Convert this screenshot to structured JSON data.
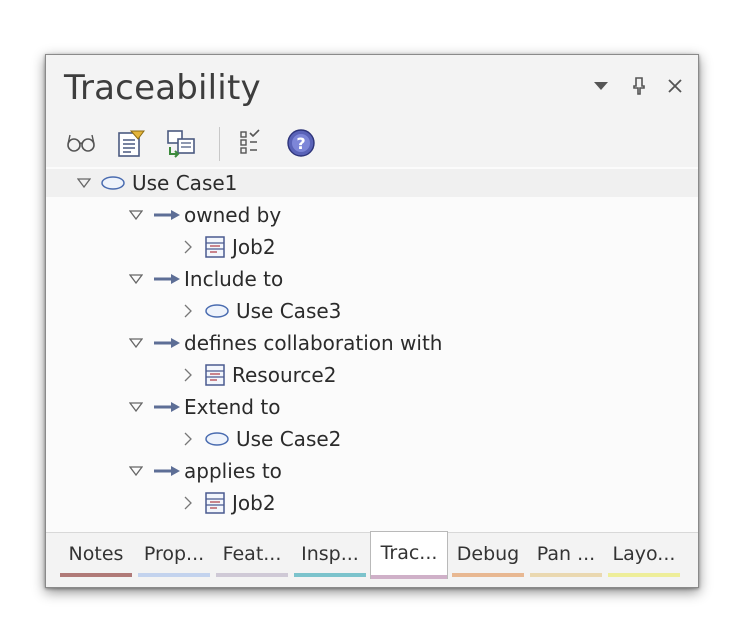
{
  "window": {
    "title": "Traceability",
    "controls": {
      "menu_icon": "dropdown-arrow-icon",
      "pin_icon": "pin-icon",
      "close_icon": "close-icon"
    }
  },
  "toolbar": {
    "buttons": [
      {
        "name": "view-icon"
      },
      {
        "name": "properties-icon"
      },
      {
        "name": "locate-icon"
      },
      {
        "name": "checklist-icon"
      },
      {
        "name": "help-icon"
      }
    ]
  },
  "tree": {
    "root": {
      "label": "Use Case1",
      "icon": "use-case-icon"
    },
    "groups": [
      {
        "label": "owned by",
        "child": "Job2",
        "child_icon": "class-icon"
      },
      {
        "label": "Include to",
        "child": "Use Case3",
        "child_icon": "use-case-icon"
      },
      {
        "label": "defines collaboration with",
        "child": "Resource2",
        "child_icon": "class-icon"
      },
      {
        "label": "Extend to",
        "child": "Use Case2",
        "child_icon": "use-case-icon"
      },
      {
        "label": "applies to",
        "child": "Job2",
        "child_icon": "class-icon"
      }
    ]
  },
  "tabs": [
    {
      "label": "Notes",
      "color": "#b07a78"
    },
    {
      "label": "Prop...",
      "color": "#c3d3ee"
    },
    {
      "label": "Feat...",
      "color": "#cfc9d6"
    },
    {
      "label": "Insp...",
      "color": "#7cc3cc"
    },
    {
      "label": "Trac...",
      "color": "#cfb0c8",
      "active": true
    },
    {
      "label": "Debug",
      "color": "#e8b892"
    },
    {
      "label": "Pan ...",
      "color": "#ead8b0"
    },
    {
      "label": "Layo...",
      "color": "#eeee9a"
    }
  ],
  "colors": {
    "accent_arrow": "#5d6e96",
    "panel_bg": "#fbfbfb",
    "header_bg": "#f3f3f3"
  }
}
